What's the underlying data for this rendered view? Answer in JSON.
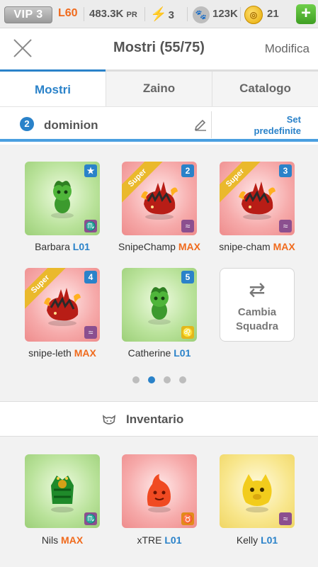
{
  "status": {
    "vip": "VIP 3",
    "level": "L60",
    "power": "483.3K",
    "power_unit": "PR",
    "energy": "3",
    "paw_value": "123K",
    "coins": "21",
    "add_label": "+"
  },
  "header": {
    "title": "Mostri (55/75)",
    "edit": "Modifica"
  },
  "tabs": [
    {
      "label": "Mostri",
      "active": true
    },
    {
      "label": "Zaino",
      "active": false
    },
    {
      "label": "Catalogo",
      "active": false
    }
  ],
  "team": {
    "number": "2",
    "name": "dominion",
    "presets_line1": "Set",
    "presets_line2": "predefinite"
  },
  "team_monsters": [
    {
      "name": "Barbara",
      "level": "L01",
      "max": false,
      "color": "green",
      "badge": "★",
      "sign": "♏",
      "sign_color": "purple",
      "super": false
    },
    {
      "name": "SnipeChamp",
      "level": "MAX",
      "max": true,
      "color": "red",
      "badge": "2",
      "sign": "≈",
      "sign_color": "purple",
      "super": true
    },
    {
      "name": "snipe-cham",
      "level": "MAX",
      "max": true,
      "color": "red",
      "badge": "3",
      "sign": "≈",
      "sign_color": "purple",
      "super": true
    },
    {
      "name": "snipe-leth",
      "level": "MAX",
      "max": true,
      "color": "red",
      "badge": "4",
      "sign": "≈",
      "sign_color": "purple",
      "super": true
    },
    {
      "name": "Catherine",
      "level": "L01",
      "max": false,
      "color": "green",
      "badge": "5",
      "sign": "♌",
      "sign_color": "yellow",
      "super": false
    }
  ],
  "super_label": "Super",
  "swap": {
    "line1": "Cambia",
    "line2": "Squadra"
  },
  "pager": {
    "pages": 4,
    "current": 2
  },
  "inventory": {
    "label": "Inventario",
    "items": [
      {
        "name": "Nils",
        "level": "MAX",
        "max": true,
        "color": "green",
        "sign": "♏",
        "sign_color": "purple"
      },
      {
        "name": "xTRE",
        "level": "L01",
        "max": false,
        "color": "red",
        "sign": "♉",
        "sign_color": "orange"
      },
      {
        "name": "Kelly",
        "level": "L01",
        "max": false,
        "color": "yellow",
        "sign": "≈",
        "sign_color": "purple"
      }
    ]
  },
  "colors": {
    "accent": "#2a82c9",
    "max": "#f06a1c",
    "level": "#2a82c9"
  }
}
